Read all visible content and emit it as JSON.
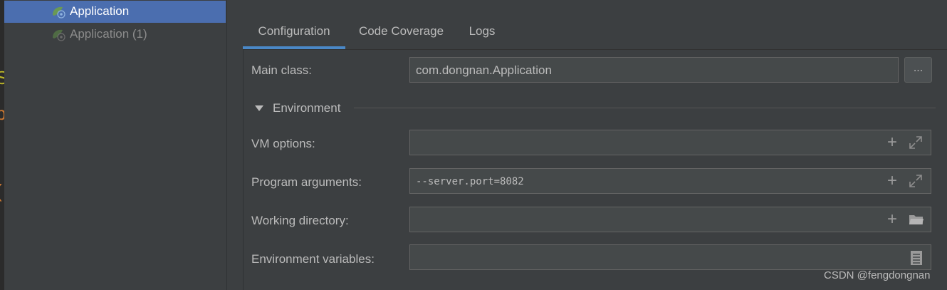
{
  "sidebar": {
    "items": [
      {
        "label": "Application",
        "icon": "spring-boot-run-config-icon",
        "selected": true
      },
      {
        "label": "Application (1)",
        "icon": "spring-boot-run-config-icon",
        "selected": false
      }
    ]
  },
  "tabs": [
    {
      "label": "Configuration",
      "active": true
    },
    {
      "label": "Code Coverage",
      "active": false
    },
    {
      "label": "Logs",
      "active": false
    }
  ],
  "form": {
    "main_class_label": "Main class:",
    "main_class_value": "com.dongnan.Application",
    "browse_label": "...",
    "environment_section": "Environment",
    "vm_options_label": "VM options:",
    "vm_options_value": "",
    "program_args_label": "Program arguments:",
    "program_args_value": "--server.port=8082",
    "working_dir_label": "Working directory:",
    "working_dir_value": "",
    "env_vars_label": "Environment variables:",
    "env_vars_value": ""
  },
  "icons": {
    "add": "plus-icon",
    "expand": "expand-icon",
    "folder": "folder-icon",
    "edit_list": "document-icon",
    "collapse": "triangle-down-icon"
  },
  "watermark": "CSDN @fengdongnan",
  "colors": {
    "background": "#3c3f41",
    "selection": "#4b6eaf",
    "tab_underline": "#4a88c7",
    "field_bg": "#45494a",
    "text": "#bbbbbb"
  }
}
